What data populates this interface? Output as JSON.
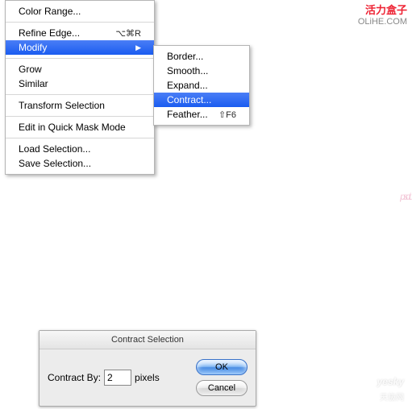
{
  "watermarks": {
    "top_red": "活力盒子",
    "top_gray": "OLiHE.COM",
    "bottom_brand": "yesky",
    "bottom_sub": "天极网"
  },
  "main_menu": {
    "items": [
      {
        "label": "Color Range...",
        "shortcut": ""
      },
      {
        "sep": true
      },
      {
        "label": "Refine Edge...",
        "shortcut": "⌥⌘R"
      },
      {
        "label": "Modify",
        "shortcut": "",
        "arrow": true,
        "highlight": true
      },
      {
        "sep": true
      },
      {
        "label": "Grow",
        "shortcut": ""
      },
      {
        "label": "Similar",
        "shortcut": ""
      },
      {
        "sep": true
      },
      {
        "label": "Transform Selection",
        "shortcut": ""
      },
      {
        "sep": true
      },
      {
        "label": "Edit in Quick Mask Mode",
        "shortcut": ""
      },
      {
        "sep": true
      },
      {
        "label": "Load Selection...",
        "shortcut": ""
      },
      {
        "label": "Save Selection...",
        "shortcut": ""
      }
    ]
  },
  "submenu": {
    "items": [
      {
        "label": "Border...",
        "shortcut": ""
      },
      {
        "label": "Smooth...",
        "shortcut": ""
      },
      {
        "label": "Expand...",
        "shortcut": ""
      },
      {
        "label": "Contract...",
        "shortcut": "",
        "highlight": true
      },
      {
        "label": "Feather...",
        "shortcut": "⇧F6"
      }
    ]
  },
  "dialog": {
    "title": "Contract Selection",
    "field_label": "Contract By:",
    "field_value": "2",
    "units": "pixels",
    "ok": "OK",
    "cancel": "Cancel"
  },
  "canvas_text": "psdtut"
}
